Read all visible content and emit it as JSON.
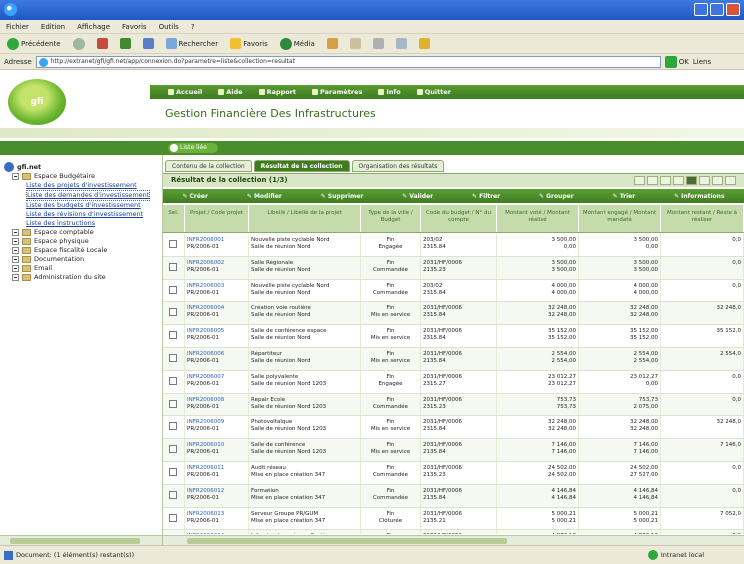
{
  "menu": [
    "Fichier",
    "Edition",
    "Affichage",
    "Favoris",
    "Outils",
    "?"
  ],
  "toolbar": {
    "back": "Précédente",
    "search": "Rechercher",
    "favorites": "Favoris",
    "media": "Média"
  },
  "address": {
    "label": "Adresse",
    "url": "http://extranet/gfi/gfi.net/app/connexion.do?parametre=liste&collection=resultat",
    "go": "OK",
    "links": "Liens"
  },
  "header": {
    "logo_text": "gfi",
    "nav": [
      "Accueil",
      "Aide",
      "Rapport",
      "Paramètres",
      "Info",
      "Quitter"
    ],
    "title": "Gestion Financière Des Infrastructures"
  },
  "strip": {
    "badge": "Liste liée"
  },
  "sidebar": {
    "root": "gfi.net",
    "group_open": "Espace Budgétaire",
    "items": [
      "Liste des projets d'investissement",
      "Liste des demandes d'investissement",
      "Liste des budgets d'investissement",
      "Liste des révisions d'investissement",
      "Liste des instructions"
    ],
    "groups": [
      "Espace comptable",
      "Espace physique",
      "Espace fiscalité Locale",
      "Documentation",
      "Email",
      "Administration du site"
    ]
  },
  "tabs": [
    "Contenu de la collection",
    "Résultat de la collection",
    "Organisation des résultats"
  ],
  "panel": {
    "title": "Résultat de la collection (1/3)"
  },
  "actions": [
    "Créer",
    "Modifier",
    "Supprimer",
    "Valider",
    "Filtrer",
    "Grouper",
    "Trier",
    "Informations"
  ],
  "columns": [
    "Sel.",
    "Projet / Code projet",
    "Libellé / Libellé de la projet",
    "Type de la ville / Budget",
    "Code du budget / N° du compte",
    "Montant voté / Montant réalisé",
    "Montant engagé / Montant mandaté",
    "Montant restant / Reste à réaliser"
  ],
  "rows": [
    {
      "p1": "INFR2006001",
      "p2": "PR/2006-01",
      "l1": "Nouvelle piste cyclable Nord",
      "l2": "Salle de réunion Nord",
      "t1": "Fin",
      "t2": "Engagée",
      "c1": "203/02",
      "c2": "2315.84",
      "a1": "3 500,00",
      "a2": "0,00",
      "b1": "3 500,00",
      "b2": "0,00",
      "r": "0,0"
    },
    {
      "p1": "INFR2006002",
      "p2": "PR/2006-01",
      "l1": "Salle Régionale",
      "l2": "Salle de réunion Nord",
      "t1": "Fin",
      "t2": "Commandée",
      "c1": "2031/HF/0006",
      "c2": "2135.23",
      "a1": "3 500,00",
      "a2": "3 500,00",
      "b1": "3 500,00",
      "b2": "3 500,00",
      "r": "0,0"
    },
    {
      "p1": "INFR2006003",
      "p2": "PR/2006-01",
      "l1": "Nouvelle piste cyclable Nord",
      "l2": "Salle de réunion Nord",
      "t1": "Fin",
      "t2": "Commandée",
      "c1": "203/02",
      "c2": "2315.84",
      "a1": "4 000,00",
      "a2": "4 000,00",
      "b1": "4 000,00",
      "b2": "4 000,00",
      "r": "0,0"
    },
    {
      "p1": "INFR2006004",
      "p2": "PR/2006-01",
      "l1": "Création voie routière",
      "l2": "Salle de réunion Nord",
      "t1": "Fin",
      "t2": "Mis en service",
      "c1": "2031/HF/0006",
      "c2": "2315.84",
      "a1": "32 248,00",
      "a2": "32 248,00",
      "b1": "32 248,00",
      "b2": "32 248,00",
      "r": "32 248,0"
    },
    {
      "p1": "INFR2006005",
      "p2": "PR/2006-01",
      "l1": "Salle de conférence espace",
      "l2": "Salle de réunion Nord",
      "t1": "Fin",
      "t2": "Mis en service",
      "c1": "2031/HF/0006",
      "c2": "2315.84",
      "a1": "35 152,00",
      "a2": "35 152,00",
      "b1": "35 152,00",
      "b2": "35 152,00",
      "r": "35 152,0"
    },
    {
      "p1": "INFR2006006",
      "p2": "PR/2006-01",
      "l1": "Répartiteur",
      "l2": "Salle de réunion Nord",
      "t1": "Fin",
      "t2": "Mis en service",
      "c1": "2031/HF/0006",
      "c2": "2135.84",
      "a1": "2 554,00",
      "a2": "2 554,00",
      "b1": "2 554,00",
      "b2": "2 554,00",
      "r": "2 554,0"
    },
    {
      "p1": "INFR2006007",
      "p2": "PR/2006-01",
      "l1": "Salle polyvalente",
      "l2": "Salle de réunion Nord 1203",
      "t1": "Fin",
      "t2": "Engagée",
      "c1": "2031/HF/0006",
      "c2": "2315.27",
      "a1": "23 012,27",
      "a2": "23 012,27",
      "b1": "23 012,27",
      "b2": "0,00",
      "r": "0,0"
    },
    {
      "p1": "INFR2006008",
      "p2": "PR/2006-01",
      "l1": "Repair Ecole",
      "l2": "Salle de réunion Nord 1203",
      "t1": "Fin",
      "t2": "Commandée",
      "c1": "2031/HF/0006",
      "c2": "2315.23",
      "a1": "753,73",
      "a2": "753,73",
      "b1": "753,73",
      "b2": "2 075,00",
      "r": "0,0"
    },
    {
      "p1": "INFR2006009",
      "p2": "PR/2006-01",
      "l1": "Photovoltaïque",
      "l2": "Salle de réunion Nord 1203",
      "t1": "Fin",
      "t2": "Mis en service",
      "c1": "2031/HF/0006",
      "c2": "2315.84",
      "a1": "32 248,00",
      "a2": "32 248,00",
      "b1": "32 248,00",
      "b2": "32 248,00",
      "r": "32 248,0"
    },
    {
      "p1": "INFR2006010",
      "p2": "PR/2006-01",
      "l1": "Salle de conférence",
      "l2": "Salle de réunion Nord 1203",
      "t1": "Fin",
      "t2": "Mis en service",
      "c1": "2031/HF/0006",
      "c2": "2135.84",
      "a1": "7 146,00",
      "a2": "7 146,00",
      "b1": "7 146,00",
      "b2": "7 146,00",
      "r": "7 146,0"
    },
    {
      "p1": "INFR2006011",
      "p2": "PR/2006-01",
      "l1": "Audit réseau",
      "l2": "Mise en place création 347",
      "t1": "Fin",
      "t2": "Commandée",
      "c1": "2031/HF/0006",
      "c2": "2135.23",
      "a1": "24 502,00",
      "a2": "24 502,00",
      "b1": "24 502,00",
      "b2": "27 527,00",
      "r": "0,0"
    },
    {
      "p1": "INFR2006012",
      "p2": "PR/2006-01",
      "l1": "Formation",
      "l2": "Mise en place création 347",
      "t1": "Fin",
      "t2": "Commandée",
      "c1": "2031/HF/0006",
      "c2": "2135.84",
      "a1": "4 146,84",
      "a2": "4 146,84",
      "b1": "4 146,84",
      "b2": "4 146,84",
      "r": "0,0"
    },
    {
      "p1": "INFR2006013",
      "p2": "PR/2006-01",
      "l1": "Serveur Groupe PR/GUM",
      "l2": "Mise en place création 347",
      "t1": "Fin",
      "t2": "Clôturée",
      "c1": "2031/HF/0006",
      "c2": "2135.21",
      "a1": "5 000,21",
      "a2": "5 000,21",
      "b1": "5 000,21",
      "b2": "5 000,21",
      "r": "7 052,0"
    },
    {
      "p1": "INFR2006014",
      "p2": "PR/2006-01",
      "l1": "Infrastructure réseau Système",
      "l2": "Mise en place création 347",
      "t1": "Fin",
      "t2": "Mis en service",
      "c1": "2031/HF/0006",
      "c2": "2135.84",
      "a1": "4 876,13",
      "a2": "4 876,13",
      "b1": "4 876,13",
      "b2": "4 876,13",
      "r": "0,0"
    }
  ],
  "status": {
    "left": "Document: (1 élément(s) restant(s))",
    "right": "Intranet local"
  }
}
